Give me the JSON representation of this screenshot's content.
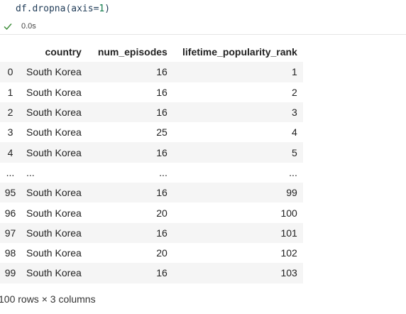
{
  "code": {
    "prefix": "df.dropna(axis=",
    "number": "1",
    "suffix": ")"
  },
  "execution": {
    "status_icon": "check-icon",
    "time": "0.0s",
    "status_color": "#388a34"
  },
  "table": {
    "headers": [
      "",
      "country",
      "num_episodes",
      "lifetime_popularity_rank"
    ],
    "rows": [
      [
        "0",
        "South Korea",
        "16",
        "1"
      ],
      [
        "1",
        "South Korea",
        "16",
        "2"
      ],
      [
        "2",
        "South Korea",
        "16",
        "3"
      ],
      [
        "3",
        "South Korea",
        "25",
        "4"
      ],
      [
        "4",
        "South Korea",
        "16",
        "5"
      ],
      [
        "...",
        "...",
        "...",
        "..."
      ],
      [
        "95",
        "South Korea",
        "16",
        "99"
      ],
      [
        "96",
        "South Korea",
        "20",
        "100"
      ],
      [
        "97",
        "South Korea",
        "16",
        "101"
      ],
      [
        "98",
        "South Korea",
        "20",
        "102"
      ],
      [
        "99",
        "South Korea",
        "16",
        "103"
      ]
    ]
  },
  "footer": "100 rows × 3 columns"
}
